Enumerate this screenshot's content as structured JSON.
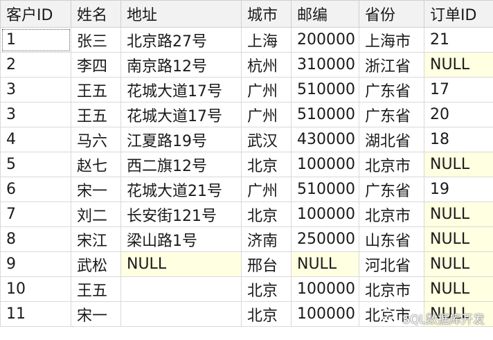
{
  "grid": {
    "columns": [
      "客户ID",
      "姓名",
      "地址",
      "城市",
      "邮编",
      "省份",
      "订单ID"
    ],
    "rows": [
      [
        "1",
        "张三",
        "北京路27号",
        "上海",
        "200000",
        "上海市",
        "21"
      ],
      [
        "2",
        "李四",
        "南京路12号",
        "杭州",
        "310000",
        "浙江省",
        "NULL"
      ],
      [
        "3",
        "王五",
        "花城大道17号",
        "广州",
        "510000",
        "广东省",
        "17"
      ],
      [
        "3",
        "王五",
        "花城大道17号",
        "广州",
        "510000",
        "广东省",
        "20"
      ],
      [
        "4",
        "马六",
        "江夏路19号",
        "武汉",
        "430000",
        "湖北省",
        "18"
      ],
      [
        "5",
        "赵七",
        "西二旗12号",
        "北京",
        "100000",
        "北京市",
        "NULL"
      ],
      [
        "6",
        "宋一",
        "花城大道21号",
        "广州",
        "510000",
        "广东省",
        "19"
      ],
      [
        "7",
        "刘二",
        "长安街121号",
        "北京",
        "100000",
        "北京市",
        "NULL"
      ],
      [
        "8",
        "宋江",
        "梁山路1号",
        "济南",
        "250000",
        "山东省",
        "NULL"
      ],
      [
        "9",
        "武松",
        "NULL",
        "邢台",
        "NULL",
        "河北省",
        "NULL"
      ],
      [
        "10",
        "王五",
        "",
        "北京",
        "100000",
        "北京市",
        "NULL"
      ],
      [
        "11",
        "宋一",
        "",
        "北京",
        "100000",
        "北京市",
        "NULL"
      ]
    ],
    "null_marker": "NULL",
    "null_background": "#ffffe1",
    "selected_cell": {
      "row": 0,
      "column": 0
    }
  },
  "watermark": {
    "text": "SQL数据库开发",
    "icon": "wechat-icon"
  }
}
